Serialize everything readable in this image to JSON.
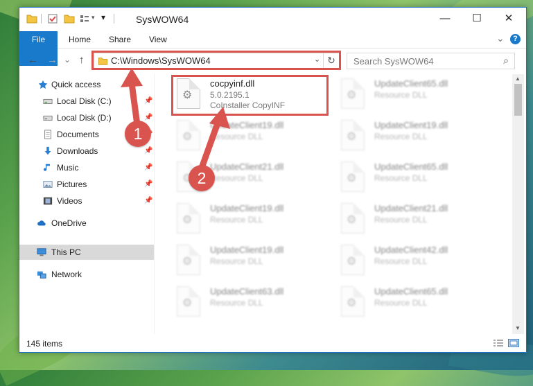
{
  "window": {
    "title": "SysWOW64",
    "minimize_label": "—",
    "maximize_label": "☐",
    "close_label": "✕"
  },
  "ribbon": {
    "tabs": [
      {
        "label": "File"
      },
      {
        "label": "Home"
      },
      {
        "label": "Share"
      },
      {
        "label": "View"
      }
    ],
    "expand_label": "⌄",
    "help_label": "?"
  },
  "nav": {
    "back_label": "←",
    "forward_label": "→",
    "recent_label": "⌄",
    "up_label": "↑",
    "address": "C:\\Windows\\SysWOW64",
    "address_dropdown": "⌄",
    "refresh_label": "↻",
    "search_placeholder": "Search SysWOW64",
    "search_icon": "⌕"
  },
  "sidebar": {
    "items": [
      {
        "label": "Quick access",
        "icon": "star-icon"
      },
      {
        "label": "Local Disk (C:)",
        "icon": "drive-icon",
        "pinned": true
      },
      {
        "label": "Local Disk (D:)",
        "icon": "drive-icon",
        "pinned": true
      },
      {
        "label": "Documents",
        "icon": "documents-icon",
        "pinned": true
      },
      {
        "label": "Downloads",
        "icon": "download-icon",
        "pinned": true
      },
      {
        "label": "Music",
        "icon": "music-icon",
        "pinned": true
      },
      {
        "label": "Pictures",
        "icon": "pictures-icon",
        "pinned": true
      },
      {
        "label": "Videos",
        "icon": "videos-icon",
        "pinned": true
      },
      {
        "label": "OneDrive",
        "icon": "cloud-icon"
      },
      {
        "label": "This PC",
        "icon": "computer-icon",
        "selected": true
      },
      {
        "label": "Network",
        "icon": "network-icon"
      }
    ],
    "pin_glyph": "📌"
  },
  "files": [
    {
      "name": "cocpyinf.dll",
      "line1": "5.0.2195.1",
      "line2": "CoInstaller CopyINF",
      "highlight": true
    },
    {
      "name": "UpdateClient65.dll",
      "line1": "Resource DLL"
    },
    {
      "name": "UpdateClient19.dll",
      "line1": "Resource DLL"
    },
    {
      "name": "UpdateClient19.dll",
      "line1": "Resource DLL"
    },
    {
      "name": "UpdateClient21.dll",
      "line1": "Resource DLL"
    },
    {
      "name": "UpdateClient65.dll",
      "line1": "Resource DLL"
    },
    {
      "name": "UpdateClient19.dll",
      "line1": "Resource DLL"
    },
    {
      "name": "UpdateClient21.dll",
      "line1": "Resource DLL"
    },
    {
      "name": "UpdateClient19.dll",
      "line1": "Resource DLL"
    },
    {
      "name": "UpdateClient42.dll",
      "line1": "Resource DLL"
    },
    {
      "name": "UpdateClient63.dll",
      "line1": "Resource DLL"
    },
    {
      "name": "UpdateClient65.dll",
      "line1": "Resource DLL"
    }
  ],
  "status": {
    "item_count": "145 items"
  },
  "callouts": [
    {
      "label": "1"
    },
    {
      "label": "2"
    }
  ],
  "colors": {
    "accent": "#1979ca",
    "callout": "#d9544f"
  }
}
